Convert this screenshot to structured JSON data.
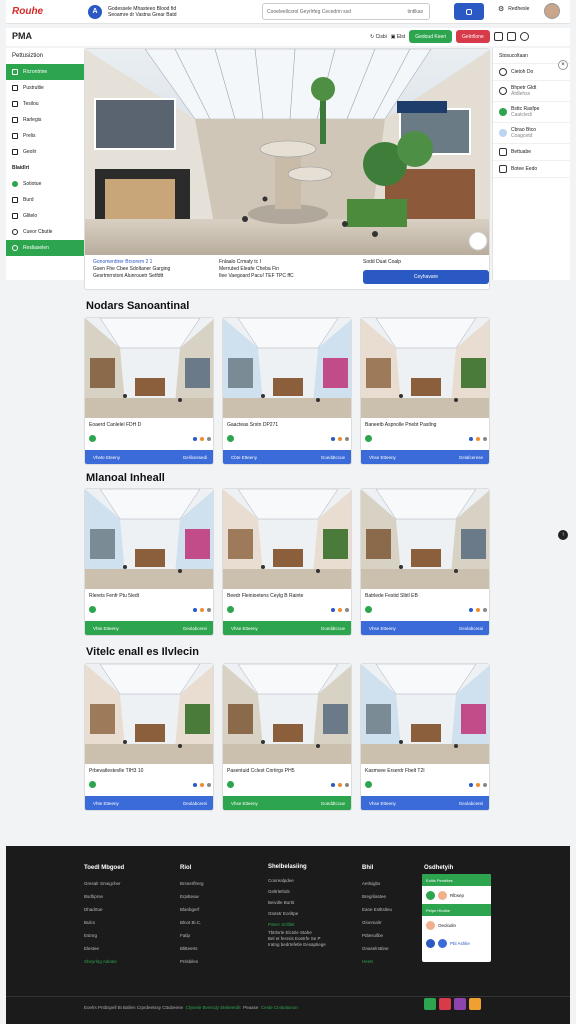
{
  "topbar": {
    "logo_main": "Rouhe",
    "logo_mark": "",
    "brand_initial": "A",
    "brand_line1": "Godessele Mhasteeo Blood fid",
    "brand_line2": "Seoamre dr Vastna Grear Batd",
    "search_placeholder": "Cooeleellcsrol Geyrlrfeg Cecedrin ssd",
    "search_hint": "tintlkas",
    "user_label": "Redhesle"
  },
  "page_header": {
    "title": "PMA",
    "action1": "Cisbi",
    "action2": "Elst",
    "action3": "Gedoud Keeri",
    "action4": "Gelrrllone"
  },
  "sidebar": {
    "head": "Pettusiztion",
    "items": [
      "Ricrontrine",
      "Pustrultie",
      "Tesilou",
      "Rarlegis",
      "Prelis",
      "Geolir",
      "Blaidlrt",
      "Sotiotue",
      "Burd",
      "Glitelo",
      "Cueor Cbutle",
      "Resliaselen"
    ]
  },
  "hero": {
    "badge": "",
    "col1_line1": "Gonomenttrer Brsorem 2 1",
    "col1_line2": "Gsen Fhe Cbee Sdoltaner Garging",
    "col1_line3": "Gesrtmrrstoni Alunrouetr Setfdtt",
    "col2_line1": "Fnlaalo Crmaty tc I",
    "col2_line2": "Merruted Eleafe Cheba Fin",
    "col2_line3": "Ilee Vaegoard Pacu! TEF TPC ffC",
    "col3_line1": "Sodd Duat Coalp",
    "btn": "Ceyhavare"
  },
  "right_panel": {
    "head": "Stosucoltaan",
    "items": [
      {
        "title": "Cietoh Do",
        "sub": ""
      },
      {
        "title": "Bhpetr Gldt",
        "sub": "Atdlehss"
      },
      {
        "title": "Bsttc Rasfpe",
        "sub": "Caatcledi"
      },
      {
        "title": "Cbrao Btco",
        "sub": "Coagcetd"
      },
      {
        "title": "Bettuabe",
        "sub": ""
      },
      {
        "title": "Botee Eedo",
        "sub": ""
      }
    ]
  },
  "sections": [
    {
      "title": "Nodars Sanoantinal",
      "cards": [
        {
          "name": "Eoaerd Canlelel FDH D",
          "btn": "Vhete Eteeny",
          "btn_right": "Gelilcessedi",
          "tag": ""
        },
        {
          "name": "Gaacteas Srstn DP271",
          "btn": "Cbte Etteeny",
          "btn_right": "Goeddtccue",
          "tag": ""
        },
        {
          "name": "Baneetb Aspnolle Pnebt Pastlng",
          "btn": "Vhse Etteeny",
          "btn_right": "Gelafcerese",
          "tag": ""
        }
      ]
    },
    {
      "title": "Mlanoal Inheall",
      "cards": [
        {
          "name": "Rlerets Fenfr Ptu 5ledt",
          "btn": "Vhte Etteeny",
          "btn_right": "Geolabcerei",
          "tag": ""
        },
        {
          "name": "Beedr Fleinioetens Ceylg B Rainte",
          "btn": "Vhse Etteeny",
          "btn_right": "Goeddtccue",
          "tag": ""
        },
        {
          "name": "Batrlede Festid Slbtl EB",
          "btn": "Vhse Etteeny",
          "btn_right": "Geolabcerai",
          "tag": ""
        }
      ]
    },
    {
      "title": "Vitelc enall es Ilvlecin",
      "cards": [
        {
          "name": "Prbevatlestevlle TIH3 10",
          "btn": "Vhte Etteeny",
          "btn_right": "Geolabcerei",
          "tag": ""
        },
        {
          "name": "Pasentuid Cclest Cnrtirgs PH5",
          "btn": "Vhse Etteeny",
          "btn_right": "Goeddtccue",
          "tag": ""
        },
        {
          "name": "Kasmvee Erserdr Fbelt T2I",
          "btn": "Vhse Etteeny",
          "btn_right": "Geolabcerei",
          "tag": ""
        }
      ]
    }
  ],
  "footer": {
    "cols": [
      {
        "head": "Toedl Mbgoed",
        "items": [
          "Gresalr Srsegcher",
          "Bsdhprse",
          "Dhadrtoe",
          "Bulcs",
          "Estnrg",
          "Elestee",
          "Sheyrlng Adeats"
        ]
      },
      {
        "head": "Riol",
        "items": [
          "Brsnerflrerg",
          "Erpitteuw",
          "Blanbgerf",
          "Blnot Bi.C.",
          "Fatlp",
          "Blitteerts",
          "Pnlsbiles"
        ]
      },
      {
        "head": "Shelbelasiing",
        "items": [
          "Conrealpdee",
          "Geltrlethds",
          "Beivitle Bortit",
          "Gtotetr Eoriltpe",
          "Palerr Scltllet",
          "Tbtrlsrle Elctsle Stahe",
          "Bel et fesrsis Eoetrfe Se P",
          "Iratng bedrtefetle Eesaptiege"
        ]
      },
      {
        "head": "Bhil",
        "items": [
          "Aetlsigbs",
          "Bregrilastee",
          "Eane Estltstleu",
          "Glonmalrr",
          "Pdtesollbe",
          "Gnaselrsttine",
          "Heett"
        ]
      }
    ],
    "widget_title": "Osdhetyih",
    "widget_band1": "Eoltls Pendttes",
    "widget_row1": "Rlbsep",
    "widget_band2": "Pelpe Hbolbe",
    "widget_row2": "Oeolodin",
    "widget_row3": "Pbl Ashlie",
    "bottom_text": "Eoelrs Pntbspell Bi Ballen Crprdeetssy Cttubeene",
    "bottom_hi1": "Clyseiie Bvrecdy Stebeerdit",
    "bottom_mid": "Peaase",
    "bottom_hi2": "Ceste Cmitoitunon"
  },
  "colors": {
    "accent_blue": "#2b59c3",
    "accent_green": "#2da44e",
    "accent_red": "#d73a49",
    "footer_bg": "#1b1b1b"
  }
}
